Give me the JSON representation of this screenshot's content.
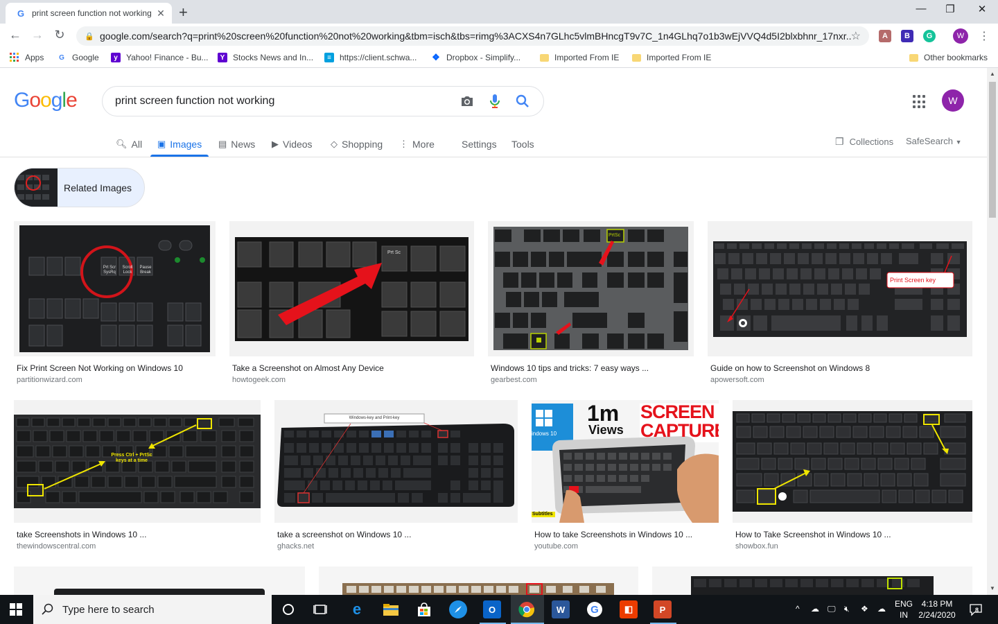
{
  "browser": {
    "tab_title": "print screen function not working",
    "url": "google.com/search?q=print%20screen%20function%20not%20working&tbm=isch&tbs=rimg%3ACXS4n7GLhc5vlmBHncgT9v7C_1n4GLhq7o1b3wEjVVQ4d5I2blxbhnr_17nxr...",
    "bookmarks": [
      "Apps",
      "Google",
      "Yahoo! Finance - Bu...",
      "Stocks News and In...",
      "https://client.schwa...",
      "Dropbox - Simplify...",
      "Imported From IE",
      "Imported From IE",
      "Other bookmarks"
    ],
    "profile_initial": "W"
  },
  "google": {
    "logo": "Google",
    "query": "print screen function not working",
    "tabs": [
      "All",
      "Images",
      "News",
      "Videos",
      "Shopping",
      "More",
      "Settings",
      "Tools"
    ],
    "active_tab": "Images",
    "collections": "Collections",
    "safesearch": "SafeSearch",
    "avatar_initial": "W",
    "related": "Related Images"
  },
  "results": [
    {
      "title": "Fix Print Screen Not Working on Windows 10",
      "source": "partitionwizard.com"
    },
    {
      "title": "Take a Screenshot on Almost Any Device",
      "source": "howtogeek.com"
    },
    {
      "title": "Windows 10 tips and tricks: 7 easy ways ...",
      "source": "gearbest.com"
    },
    {
      "title": "Guide on how to Screenshot on Windows 8",
      "source": "apowersoft.com"
    },
    {
      "title": "take Screenshots in Windows 10 ...",
      "source": "thewindowscentral.com"
    },
    {
      "title": "take a screenshot on Windows 10 ...",
      "source": "ghacks.net"
    },
    {
      "title": "How to take Screenshots in Windows 10 ...",
      "source": "youtube.com"
    },
    {
      "title": "How to Take Screenshot in Windows 10 ...",
      "source": "showbox.fun"
    }
  ],
  "image_text": {
    "prtsc1": "Prt Scr SysRq",
    "scroll": "Scroll Lock",
    "pause": "Pause Break",
    "prtsc2": "Prt Sc",
    "prtsc3": "PrtSc",
    "callout": "Print Screen key",
    "press": "Press Ctrl + PrtSc keys at a time",
    "winkey": "Windows-key and Print-key",
    "views_big": "1m",
    "views_small": "Views",
    "screen": "SCREEN",
    "capture": "CAPTURE",
    "windows10": "indows 10",
    "subtitles": "Subtitles"
  },
  "taskbar": {
    "search_placeholder": "Type here to search",
    "lang_top": "ENG",
    "lang_bottom": "IN",
    "time": "4:18 PM",
    "date": "2/24/2020",
    "notif_count": "8"
  },
  "colors": {
    "accent": "#1a73e8",
    "google_blue": "#4285f4",
    "google_red": "#ea4335",
    "google_yellow": "#fbbc05",
    "google_green": "#34a853"
  }
}
